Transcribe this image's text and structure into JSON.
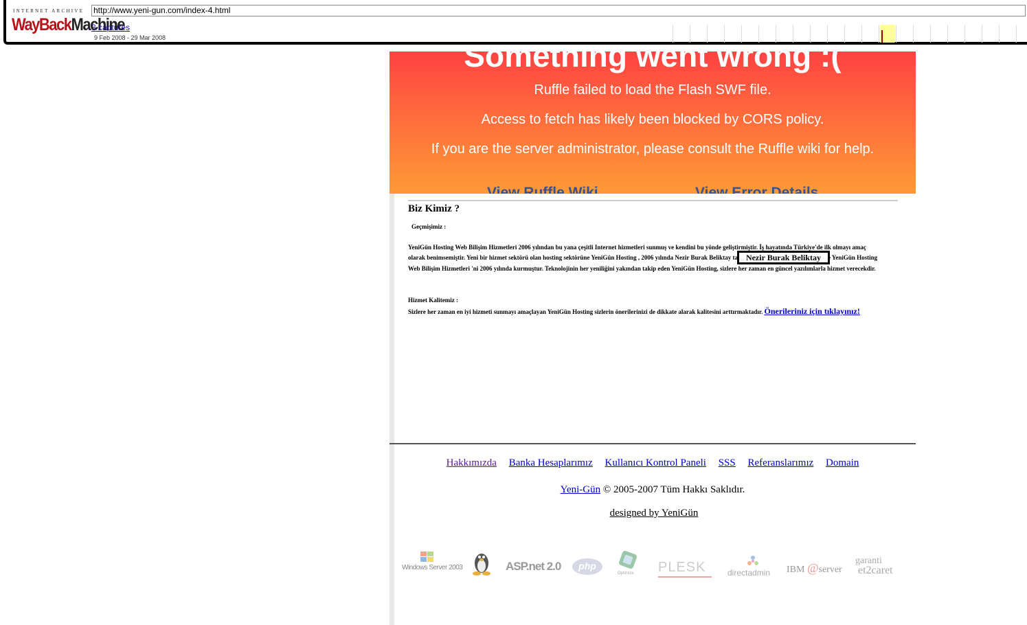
{
  "wayback": {
    "ia_label": "INTERNET ARCHIVE",
    "logo_wayback": "WayBack",
    "logo_machine": "Machine",
    "url": "http://www.yeni-gun.com/index-4.html",
    "captures": "3 captures",
    "range": "9 Feb 2008 - 29 Mar 2008"
  },
  "ruffle": {
    "headline": "Something went wrong :(",
    "line1": "Ruffle failed to load the Flash SWF file.",
    "line2": "Access to fetch has likely been blocked by CORS policy.",
    "line3": "If you are the server administrator, please consult the Ruffle wiki for help.",
    "btn_wiki": "View Ruffle Wiki",
    "btn_details": "View Error Details"
  },
  "content": {
    "title": "Biz Kimiz ?",
    "history_label": "Geçmişimiz :",
    "history_text": "YeniGün Hosting Web Bilişim Hizmetleri 2006 yılından bu yana çeşitli Internet hizmetleri sunmuş ve kendini bu yönde geliştirmiştir. İş hayatında Türkiye'de ilk olmayı amaç olarak benimsemiştir. Yeni bir hizmet sektörü olan hosting sektörüne YeniGün Hosting , 2006 yılında Nezir Burak Beliktay tarafından kurularak giriş yapmış ve YeniGün Hosting Web Bilişim Hizmetleri 'ni 2006 yılında kurmuştur. Teknolojinin her yeniliğini yakından takip eden YeniGün Hosting, sizlere her zaman en güncel yazılımlarla hizmet verecekdir.",
    "name_box": "Nezir Burak Beliktay",
    "quality_label": "Hizmet Kalitemiz :",
    "quality_text": "Sizlere her zaman en iyi hizmeti sunmayı amaçlayan YeniGün Hosting sizlerin önerilerinizi de dikkate alarak kalitesini arttırmaktadır.",
    "quality_link": "Önerileriniz için tıklayınız!"
  },
  "footer": {
    "links": [
      "Hakkımızda",
      "Banka Hesaplarımız",
      "Kullanıcı Kontrol Paneli",
      "SSS",
      "Referanslarımız",
      "Domain"
    ],
    "copy_link": "Yeni-Gün",
    "copy_text": " © 2005-2007 Tüm Hakkı Saklıdır.",
    "designed": "designed by YeniGün"
  },
  "logos": {
    "windows": "Windows Server 2003",
    "aspnet": "ASP.net 2.0",
    "php": "php",
    "optimize": "Optimize",
    "plesk": "PLESK",
    "directadmin": "directadmin",
    "ibm": "IBM",
    "ibm_server": "server",
    "garanti": "garanti",
    "etcaret": "et2caret"
  }
}
